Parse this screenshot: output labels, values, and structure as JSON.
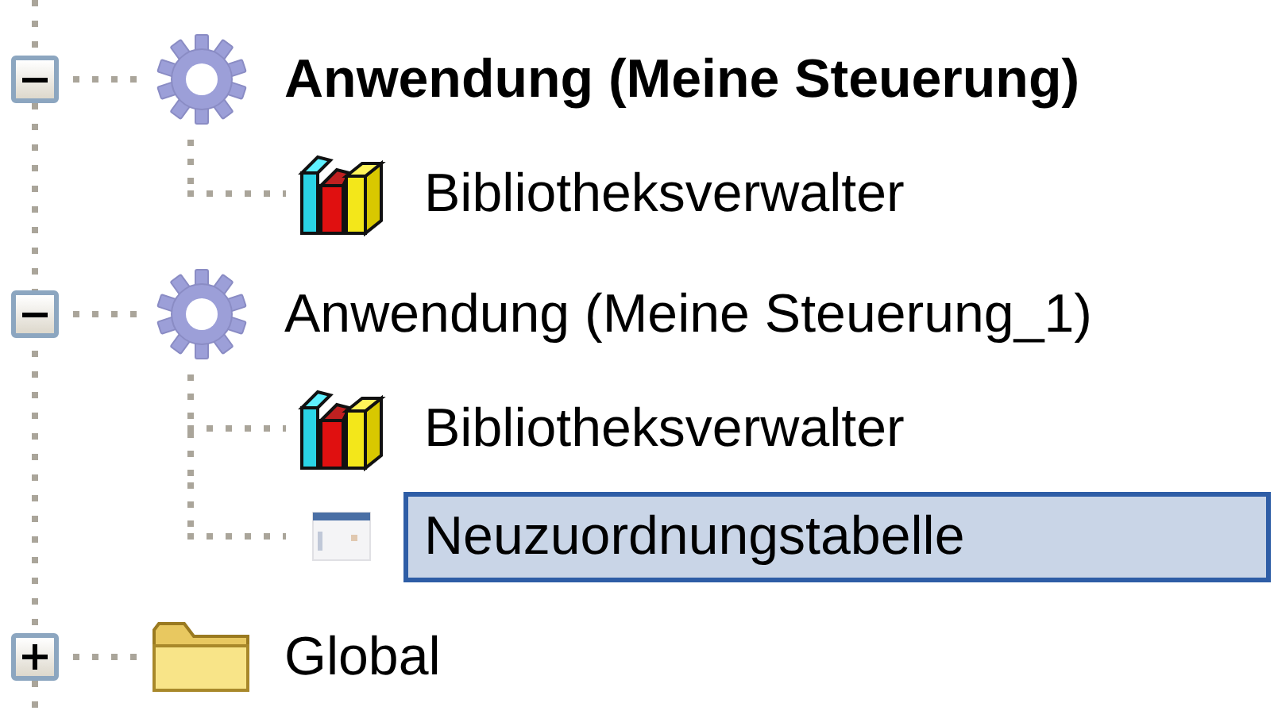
{
  "tree": [
    {
      "kind": "application",
      "label": "Anwendung (Meine Steuerung)",
      "active": true,
      "expanded": true,
      "selected": false,
      "children": [
        {
          "kind": "library",
          "label": "Bibliotheksverwalter",
          "selected": false
        }
      ]
    },
    {
      "kind": "application",
      "label": "Anwendung (Meine Steuerung_1)",
      "active": false,
      "expanded": true,
      "selected": false,
      "children": [
        {
          "kind": "library",
          "label": "Bibliotheksverwalter",
          "selected": false
        },
        {
          "kind": "table",
          "label": "Neuzuordnungstabelle",
          "selected": true
        }
      ]
    },
    {
      "kind": "folder",
      "label": "Global",
      "active": false,
      "expanded": false,
      "selected": false
    }
  ]
}
